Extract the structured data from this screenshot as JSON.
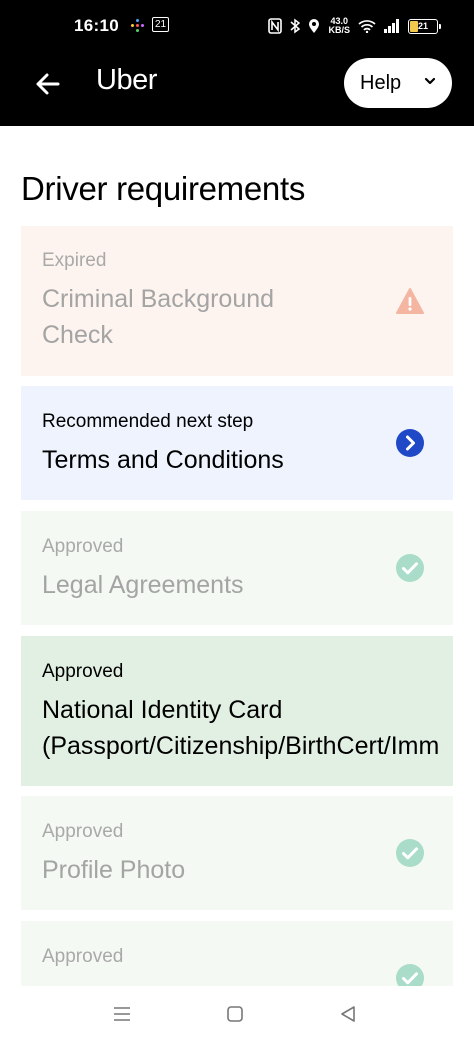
{
  "status_bar": {
    "time": "16:10",
    "notif_badge": "21",
    "net_speed_value": "43.0",
    "net_speed_unit": "KB/S",
    "battery": "21"
  },
  "app_bar": {
    "brand": "Uber",
    "help_label": "Help",
    "icons": {
      "back": "arrow-left-icon",
      "help_chevron": "chevron-down-icon"
    }
  },
  "page": {
    "title": "Driver requirements"
  },
  "requirements": [
    {
      "status": "Expired",
      "title": "Criminal Background Check",
      "icon": "warning-icon"
    },
    {
      "status": "Recommended next step",
      "title": "Terms and Conditions",
      "icon": "chevron-right-icon"
    },
    {
      "status": "Approved",
      "title": "Legal Agreements",
      "icon": "check-circle-icon"
    },
    {
      "status": "Approved",
      "title_line1": "National Identity Card",
      "title_line2": "(Passport/Citizenship/BirthCert/Imm"
    },
    {
      "status": "Approved",
      "title": "Profile Photo",
      "icon": "check-circle-icon"
    },
    {
      "status": "Approved",
      "icon": "check-circle-icon"
    }
  ],
  "colors": {
    "expired_bg": "#fdf4f0",
    "warning": "#f4b5a1",
    "next_bg": "#eef3fe",
    "next_icon": "#1f49c6",
    "approved_bg": "#f4f9f3",
    "approved_active_bg": "#e2f0e3",
    "check": "#a9dcc9"
  },
  "nav_bar": {
    "icons": [
      "menu-icon",
      "home-square-icon",
      "back-triangle-icon"
    ]
  }
}
